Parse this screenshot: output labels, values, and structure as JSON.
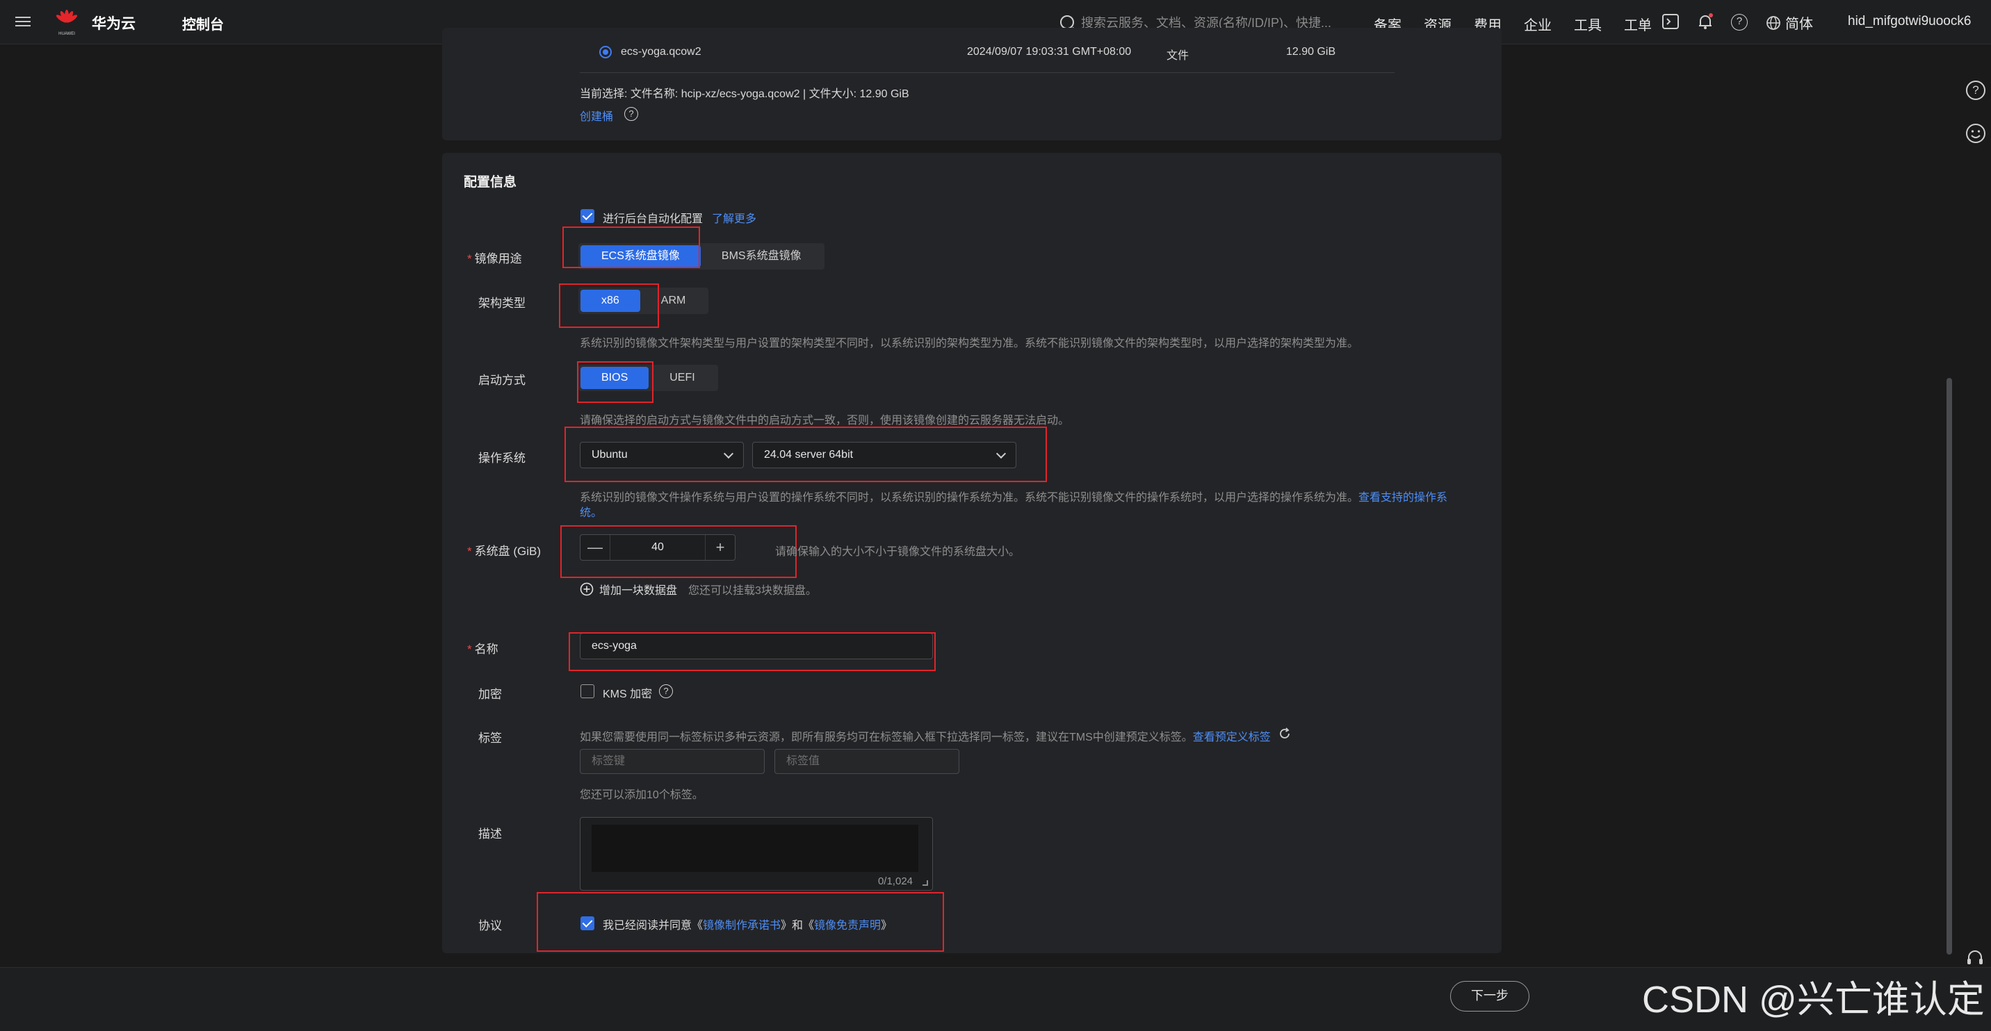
{
  "topbar": {
    "brand": "华为云",
    "logo_text": "HUAWEI",
    "console": "控制台",
    "search_placeholder": "搜索云服务、文档、资源(名称/ID/IP)、快捷...",
    "nav": [
      "备案",
      "资源",
      "费用",
      "企业",
      "工具",
      "工单"
    ],
    "lang": "简体",
    "user": "hid_mifgotwi9uoock6",
    "icons": [
      "terminal-icon",
      "bell-icon",
      "help-icon",
      "globe-icon"
    ]
  },
  "file_section": {
    "file_name": "ecs-yoga.qcow2",
    "file_time": "2024/09/07 19:03:31 GMT+08:00",
    "file_type": "文件",
    "file_size": "12.90 GiB",
    "current_selection": "当前选择: 文件名称: hcip-xz/ecs-yoga.qcow2 | 文件大小: 12.90 GiB",
    "create_bucket": "创建桶"
  },
  "config": {
    "title": "配置信息",
    "auto_config_label": "进行后台自动化配置",
    "learn_more": "了解更多",
    "image_usage": {
      "label": "镜像用途",
      "options": [
        "ECS系统盘镜像",
        "BMS系统盘镜像"
      ],
      "selected": 0
    },
    "arch": {
      "label": "架构类型",
      "options": [
        "x86",
        "ARM"
      ],
      "selected": 0,
      "hint": "系统识别的镜像文件架构类型与用户设置的架构类型不同时，以系统识别的架构类型为准。系统不能识别镜像文件的架构类型时，以用户选择的架构类型为准。"
    },
    "boot": {
      "label": "启动方式",
      "options": [
        "BIOS",
        "UEFI"
      ],
      "selected": 0,
      "hint": "请确保选择的启动方式与镜像文件中的启动方式一致，否则，使用该镜像创建的云服务器无法启动。"
    },
    "os": {
      "label": "操作系统",
      "family": "Ubuntu",
      "version": "24.04 server 64bit",
      "hint_line1": "系统识别的镜像文件操作系统与用户设置的操作系统不同时，以系统识别的操作系统为准。系统不能识别镜像文件的操作系统时，以用户选择的操作系统为准。",
      "hint_link1": "查看支持的操作系",
      "hint_link2": "统。"
    },
    "disk": {
      "label": "系统盘 (GiB)",
      "value": "40",
      "minus": "—",
      "plus": "+",
      "hint": "请确保输入的大小不小于镜像文件的系统盘大小。",
      "add_disk": "增加一块数据盘",
      "add_disk_hint": "您还可以挂载3块数据盘。"
    },
    "name": {
      "label": "名称",
      "value": "ecs-yoga"
    },
    "encrypt": {
      "label": "加密",
      "kms": "KMS 加密"
    },
    "tags": {
      "label": "标签",
      "hint": "如果您需要使用同一标签标识多种云资源，即所有服务均可在标签输入框下拉选择同一标签，建议在TMS中创建预定义标签。",
      "hint_link": "查看预定义标签",
      "key_placeholder": "标签键",
      "value_placeholder": "标签值",
      "remaining": "您还可以添加10个标签。"
    },
    "desc": {
      "label": "描述",
      "count": "0/1,024"
    },
    "agreement": {
      "label": "协议",
      "prefix": "我已经阅读并同意《",
      "link1": "镜像制作承诺书",
      "mid": "》和《",
      "link2": "镜像免责声明",
      "suffix": "》"
    }
  },
  "footer": {
    "next": "下一步",
    "watermark": "CSDN @兴亡谁认定"
  },
  "colors": {
    "accent": "#2c6be6",
    "link": "#4d8ef7",
    "annotation": "#e0242b",
    "required": "#e5484d"
  }
}
